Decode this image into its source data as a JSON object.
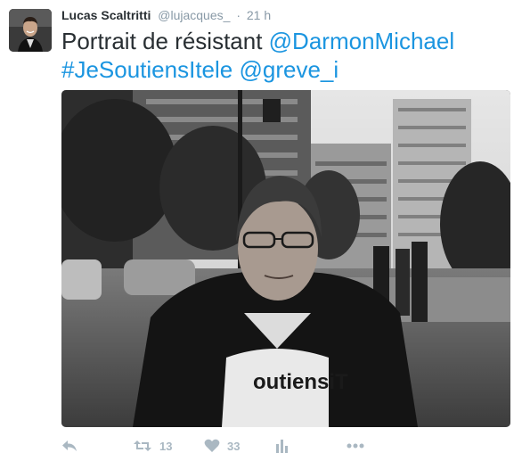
{
  "tweet": {
    "author_name": "Lucas Scaltritti",
    "handle": "@lujacques_",
    "separator": "·",
    "time": "21 h",
    "text_plain": "Portrait de résistant ",
    "mention1": "@DarmonMichael",
    "hashtag": "#JeSoutiensItele",
    "space": " ",
    "mention2": "@greve_i",
    "photo_shirt_text": "outiensiT"
  },
  "actions": {
    "retweet_count": "13",
    "like_count": "33"
  },
  "icons": {
    "reply": "reply-icon",
    "retweet": "retweet-icon",
    "like": "heart-icon",
    "analytics": "analytics-icon",
    "more": "more-icon"
  },
  "colors": {
    "link": "#1b95e0",
    "muted": "#8899a6",
    "action_icon": "#aab8c2",
    "text": "#292f33"
  }
}
